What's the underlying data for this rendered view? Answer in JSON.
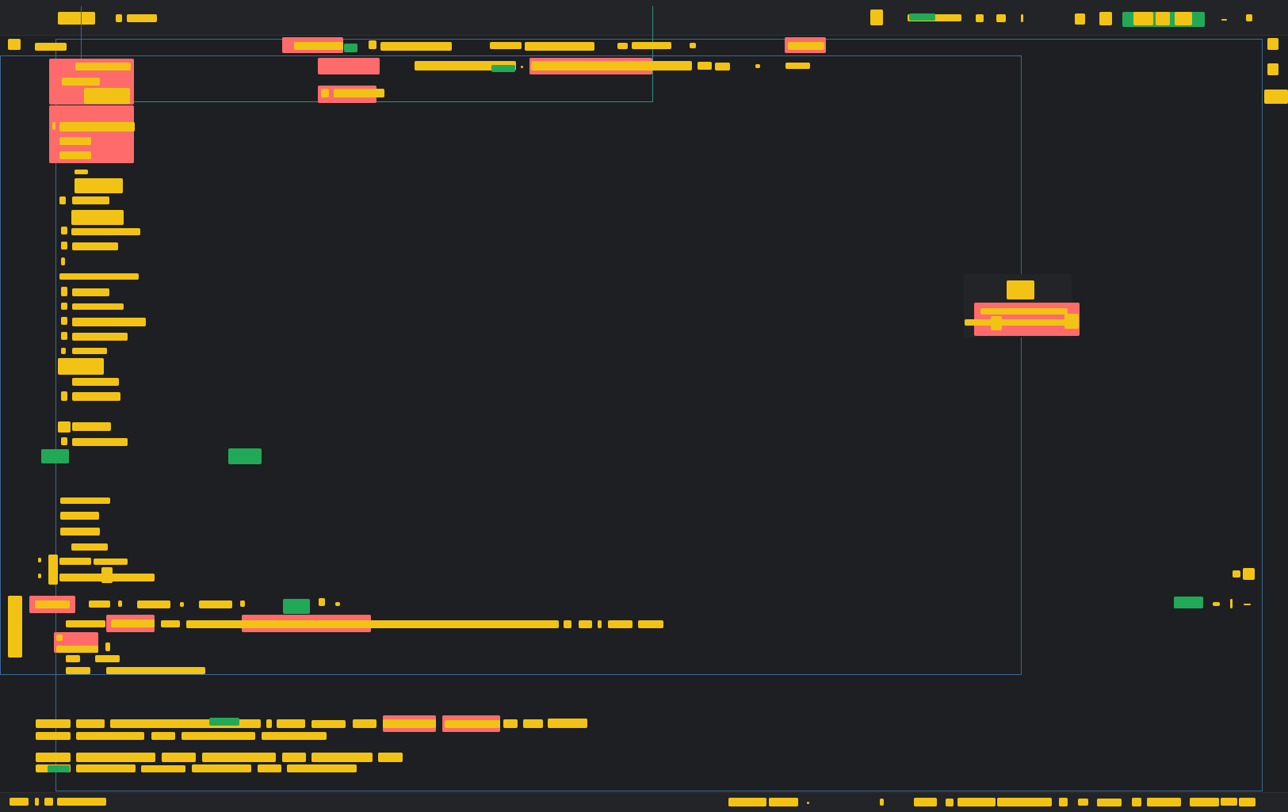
{
  "ui": {
    "note": "",
    "top_left": {
      "icon_1": "app-icon",
      "icon_2": "menu-icon"
    },
    "top_right": {
      "icons": [
        "square-icon",
        "square-icon",
        "square-icon",
        "square-icon",
        "square-icon",
        "square-icon",
        "square-icon"
      ]
    }
  },
  "colors": {
    "background": "#1e1f22",
    "panel": "#232427",
    "highlight_yellow": "#f2c314",
    "highlight_red": "#ff6b6b",
    "highlight_green": "#21a957",
    "outline_blue": "#3b6a9a",
    "outline_teal": "#2f8f86"
  }
}
